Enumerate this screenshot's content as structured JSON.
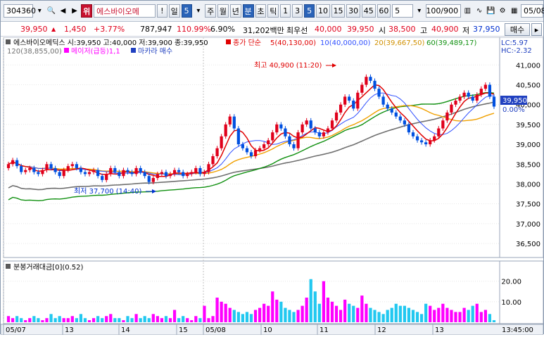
{
  "toolbar": {
    "code": "304360",
    "badge": "위",
    "stock_name": "에스바이오메",
    "bang": "!",
    "period_day": "일",
    "period_num": "5",
    "periods": [
      "주",
      "월",
      "년",
      "분",
      "초",
      "틱"
    ],
    "intervals": [
      "1",
      "3",
      "5",
      "10",
      "15",
      "30",
      "45",
      "60"
    ],
    "count": "5",
    "range": "100/900",
    "date": "05/08"
  },
  "quote": {
    "price": "39,950",
    "change": "1,450",
    "change_pct": "+3.77%",
    "volume": "787,947",
    "vol_ratio": "110.99%",
    "turnover": "6.90%",
    "amount": "31,202백만",
    "priority_label": "최우선",
    "ask": "40,000",
    "bid": "39,950",
    "open_label": "시",
    "open": "38,500",
    "high_label": "고",
    "high": "40,900",
    "low_label": "저",
    "low": "37,950",
    "buy_btn": "매수"
  },
  "legend": {
    "ohlc": "에스바이오메딕스 시:39,950 고:40,000 저:39,900 종:39,950",
    "ma_label": "종가 단순",
    "ma5": "5(40,130,00)",
    "ma10": "10(40,000,00)",
    "ma20": "20(39,667,50)",
    "ma60": "60(39,489,17)",
    "ma120": "120(38,855,00)",
    "signal1": "메이저(급등)1,1",
    "signal2": "마카라 매수"
  },
  "annotations": {
    "high": "최고 40,900 (11:20)",
    "low": "최저 37,700 (14:40)"
  },
  "right_panel": {
    "lc": "LC:5.97",
    "hc": "HC:-2.32",
    "price_box": "39,950",
    "price_pct": "0.00%"
  },
  "volume_panel": {
    "title": "분봉거래대금[0](0.52)"
  },
  "time_axis": [
    "05/07",
    "13",
    "14",
    "15",
    "05/08",
    "10",
    "11",
    "12",
    "13"
  ],
  "time_label": "13:45:00",
  "colors": {
    "up": "#e0001b",
    "down": "#0050e0",
    "ma5": "#e00000",
    "ma10": "#3050ff",
    "ma20": "#f0a000",
    "ma60": "#109010",
    "ma120": "#707070",
    "vol_magenta": "#ff00ff",
    "vol_cyan": "#22c8f0"
  },
  "chart_data": {
    "type": "candlestick",
    "ylim": [
      36200,
      41200
    ],
    "y_ticks": [
      36500,
      37000,
      37500,
      38000,
      38500,
      39000,
      39500,
      40000,
      40500,
      41000
    ],
    "y_tick_labels": [
      "36,500",
      "37,000",
      "37,500",
      "38,000",
      "38,500",
      "39,000",
      "39,500",
      "40,000",
      "40,500",
      "41,000"
    ],
    "close": [
      38500,
      38600,
      38450,
      38300,
      38350,
      38400,
      38300,
      38250,
      38350,
      38500,
      38400,
      38300,
      38200,
      38350,
      38450,
      38500,
      38400,
      38300,
      38250,
      38300,
      38350,
      38200,
      38100,
      38250,
      38400,
      38300,
      38200,
      38350,
      38300,
      38250,
      38400,
      38300,
      38200,
      38050,
      38150,
      38250,
      38300,
      38200,
      38250,
      38350,
      38300,
      38200,
      38250,
      38300,
      38400,
      38250,
      38300,
      38500,
      38700,
      38900,
      39200,
      39500,
      39700,
      39400,
      39000,
      38900,
      38800,
      38700,
      38850,
      38900,
      39000,
      39100,
      39300,
      39500,
      39400,
      39200,
      39000,
      38900,
      39300,
      39500,
      39600,
      39400,
      39300,
      39200,
      39300,
      39400,
      39600,
      39800,
      40000,
      40200,
      40100,
      39900,
      40300,
      40500,
      40700,
      40600,
      40400,
      40200,
      40000,
      39900,
      39800,
      39700,
      39600,
      39500,
      39300,
      39200,
      39100,
      39050,
      39000,
      39100,
      39200,
      39400,
      39600,
      39800,
      40000,
      40100,
      40200,
      40300,
      40200,
      40100,
      40250,
      40400,
      40500,
      40200,
      39950
    ],
    "volume_max": 24,
    "volume_ticks": [
      10,
      20
    ],
    "volume": [
      3,
      2,
      3,
      2,
      1,
      2,
      3,
      2,
      1,
      2,
      4,
      2,
      3,
      2,
      2,
      3,
      2,
      4,
      2,
      1,
      2,
      3,
      2,
      3,
      4,
      2,
      2,
      1,
      3,
      2,
      4,
      2,
      3,
      2,
      4,
      3,
      2,
      3,
      2,
      6,
      2,
      3,
      2,
      1,
      3,
      2,
      8,
      2,
      3,
      12,
      10,
      9,
      7,
      6,
      5,
      4,
      5,
      4,
      6,
      7,
      9,
      8,
      15,
      11,
      10,
      7,
      6,
      5,
      6,
      8,
      12,
      21,
      15,
      9,
      20,
      12,
      10,
      8,
      6,
      11,
      9,
      8,
      7,
      13,
      9,
      7,
      6,
      5,
      4,
      6,
      7,
      9,
      8,
      8,
      7,
      6,
      5,
      4,
      9,
      8,
      6,
      7,
      9,
      7,
      6,
      5,
      5,
      7,
      6,
      8,
      9,
      5,
      6,
      4,
      1
    ]
  }
}
